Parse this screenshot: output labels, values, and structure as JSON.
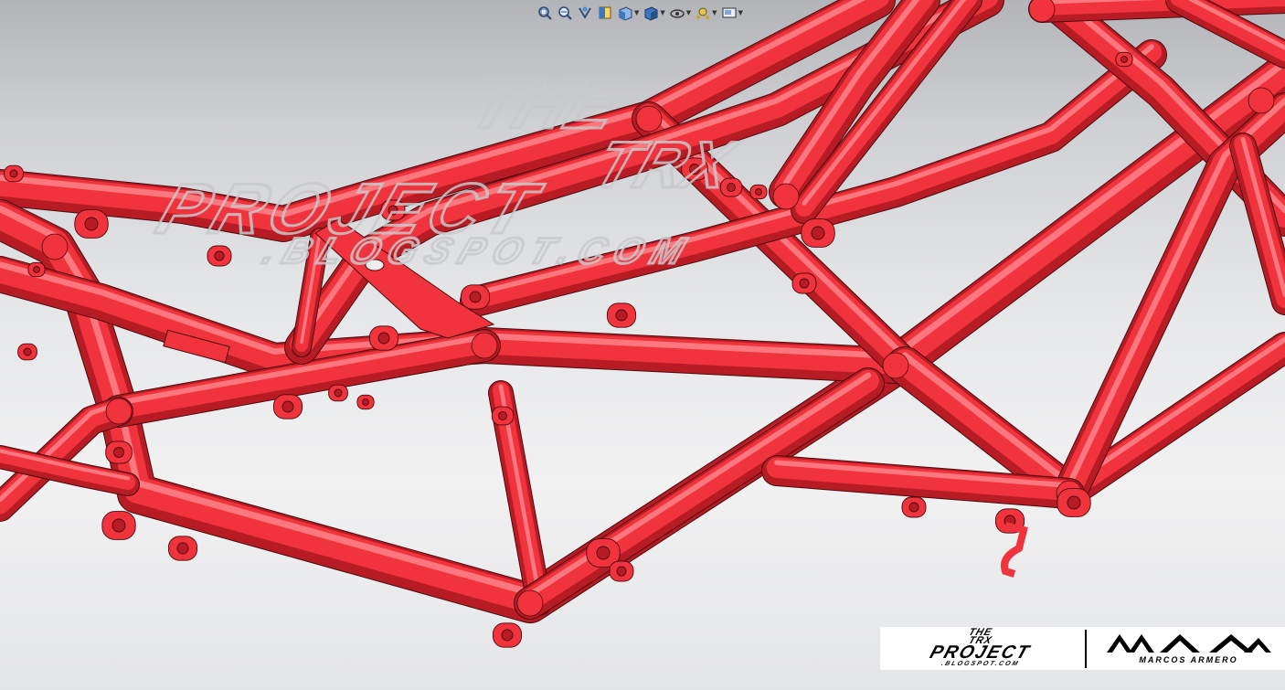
{
  "viewport": {
    "background_top": "#b3b4b8",
    "background_bottom": "#f1f1f2",
    "frame_color": "#f0333c",
    "frame_highlight": "#ff8a8f",
    "frame_shadow": "#b71c24",
    "edge_color": "#4a0a0d"
  },
  "toolbar": {
    "items": [
      {
        "icon": "zoom-to-fit-icon",
        "has_dropdown": false
      },
      {
        "icon": "zoom-to-area-icon",
        "has_dropdown": false
      },
      {
        "icon": "previous-view-icon",
        "has_dropdown": false
      },
      {
        "icon": "section-view-icon",
        "has_dropdown": false
      },
      {
        "icon": "view-orientation-icon",
        "has_dropdown": true
      },
      {
        "icon": "display-style-icon",
        "has_dropdown": true
      },
      {
        "icon": "hide-show-items-icon",
        "has_dropdown": true
      },
      {
        "icon": "edit-appearance-icon",
        "has_dropdown": true
      },
      {
        "icon": "apply-scene-icon",
        "has_dropdown": true
      }
    ]
  },
  "watermark": {
    "line1": "THE",
    "line2": "TRX",
    "line3": "PROJECT",
    "line4": ".BLOGSPOT.COM"
  },
  "logo": {
    "left_line1": "THE",
    "left_line2": "TRX",
    "left_line3": "PROJECT",
    "left_line4": ".BLOGSPOT.COM",
    "right_name": "MARCOS ARMERO"
  }
}
